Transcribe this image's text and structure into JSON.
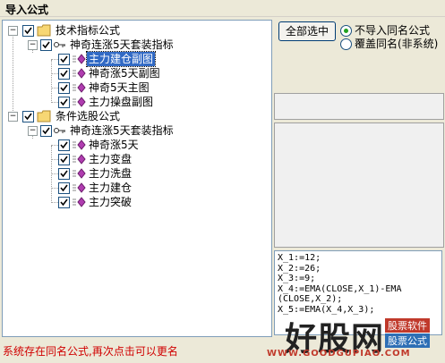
{
  "window": {
    "title": "导入公式"
  },
  "tree": {
    "group1": {
      "label": "技术指标公式",
      "set": {
        "label": "神奇连涨5天套装指标",
        "items": [
          "主力建仓副图",
          "神奇涨5天副图",
          "神奇5天主图",
          "主力操盘副图"
        ]
      }
    },
    "group2": {
      "label": "条件选股公式",
      "set": {
        "label": "神奇连涨5天套装指标",
        "items": [
          "神奇涨5天",
          "主力变盘",
          "主力洗盘",
          "主力建仓",
          "主力突破"
        ]
      }
    }
  },
  "controls": {
    "select_all": "全部选中",
    "radio_skip": "不导入同名公式",
    "radio_overwrite": "覆盖同名(非系统)"
  },
  "code_lines": [
    "X_1:=12;",
    "X_2:=26;",
    "X_3:=9;",
    "X_4:=EMA(CLOSE,X_1)-EMA",
    "(CLOSE,X_2);",
    "X_5:=EMA(X_4,X_3);"
  ],
  "status_text": "系统存在同名公式,再次点击可以更名",
  "watermark": {
    "name": "好股网",
    "tag1": "股票软件",
    "tag2": "股票公式",
    "url": "WWW.GOODGUPIAO.COM"
  },
  "colors": {
    "selected": "#316AC5",
    "status": "#D00000",
    "radio_dot": "#21A121"
  }
}
